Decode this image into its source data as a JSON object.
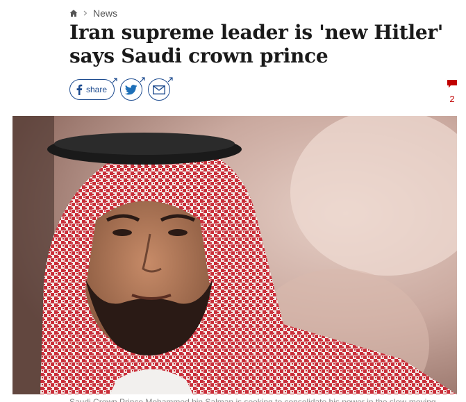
{
  "breadcrumb": {
    "home_icon": "home-icon",
    "section": "News"
  },
  "article": {
    "headline": "Iran supreme leader is 'new Hitler' says Saudi crown prince",
    "caption": "Saudi Crown Prince Mohammed bin Salman is seeking to consolidate his power in the slow-moving"
  },
  "share": {
    "facebook_label": "share",
    "icons": [
      "facebook-icon",
      "twitter-icon",
      "email-icon"
    ],
    "accent": "#1d4b8f"
  },
  "comments": {
    "count": "2",
    "color": "#c00000"
  }
}
